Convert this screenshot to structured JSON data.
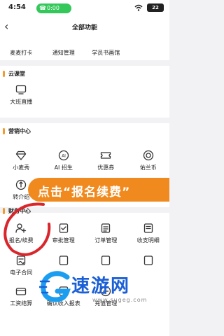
{
  "status_bar": {
    "time": "4:54",
    "call_time": "0:00",
    "battery": "22"
  },
  "nav": {
    "title": "全部功能"
  },
  "top_partial_row": [
    "麦麦打卡",
    "通知管理",
    "学员书画馆"
  ],
  "sections": {
    "cloud": {
      "title": "云课堂",
      "items": [
        "大班直播"
      ]
    },
    "marketing": {
      "title": "营销中心",
      "items": [
        "小麦秀",
        "AI 招生",
        "优惠券",
        "佑兰币",
        "转介绍"
      ]
    },
    "finance": {
      "title": "财务中心",
      "rows": [
        [
          "报名/续费",
          "审批管理",
          "订单管理",
          "收支明细"
        ],
        [
          "电子合同",
          "",
          "",
          ""
        ],
        [
          "工资结算",
          "确认收入报表",
          "充值管理",
          ""
        ]
      ]
    }
  },
  "banner": {
    "text": "点击“报名续费”"
  },
  "watermark": {
    "name": "速游网",
    "domain": "www.sugeg.com"
  },
  "colors": {
    "accent": "#f39a2e",
    "banner": "#f08a1e",
    "annotation": "#d9262c",
    "watermark": "#1b5fd6"
  }
}
